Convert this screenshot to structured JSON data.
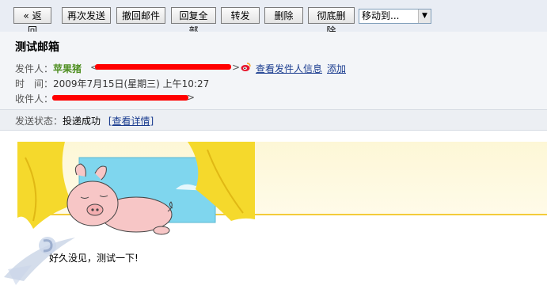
{
  "toolbar": {
    "back": "« 返回",
    "resend": "再次发送",
    "recall": "撤回邮件",
    "reply_all": "回复全部",
    "forward": "转发",
    "delete": "删除",
    "delete_permanently": "彻底删除",
    "move_to": "移动到..."
  },
  "mail": {
    "subject": "测试邮箱",
    "from_label": "发件人：",
    "from_name": "苹果猪",
    "from_open": "<",
    "from_close": ">",
    "view_sender": "查看发件人信息",
    "add": "添加",
    "time_label": "时　间：",
    "time_value": "2009年7月15日(星期三) 上午10:27",
    "to_label": "收件人：",
    "to_close": ">",
    "status_label": "发送状态：",
    "status_value": "投递成功",
    "status_detail": "[查看详情]"
  },
  "body": {
    "text": "好久没见，测试一下!"
  },
  "colors": {
    "toolbar_bg": "#e9edf4",
    "header_bg": "#f3f5f8",
    "sender_green": "#4f8f22",
    "link_blue": "#1a3c8f",
    "redaction_red": "#ff0000"
  }
}
